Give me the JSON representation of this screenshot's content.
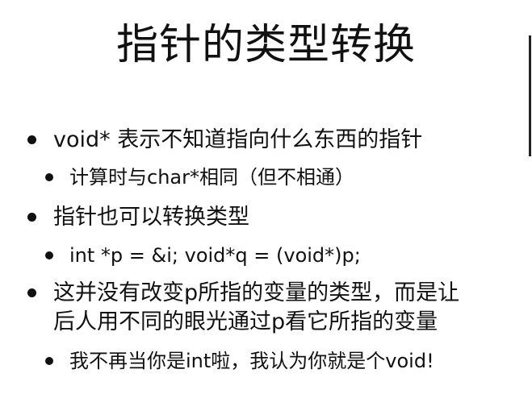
{
  "slide": {
    "title": "指针的类型转换",
    "bullets": [
      {
        "level": 1,
        "text": "void* 表示不知道指向什么东西的指针"
      },
      {
        "level": 2,
        "text": "计算时与char*相同（但不相通）"
      },
      {
        "level": 1,
        "text": "指针也可以转换类型"
      },
      {
        "level": 2,
        "text": "int *p = &i; void*q = (void*)p;"
      },
      {
        "level": 1,
        "text": "这并没有改变p所指的变量的类型，而是让",
        "continuation": "后人用不同的眼光通过p看它所指的变量"
      },
      {
        "level": 2,
        "text": "我不再当你是int啦，我认为你就是个void!"
      }
    ]
  }
}
